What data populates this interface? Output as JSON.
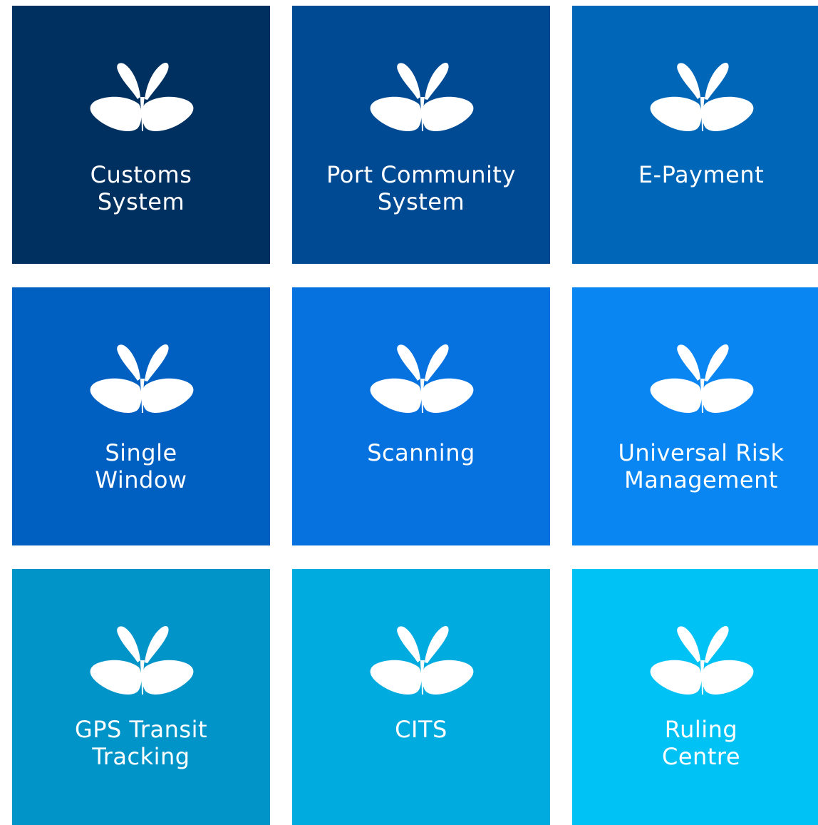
{
  "tiles": [
    {
      "id": "customs-system",
      "lines": [
        "Customs",
        "System"
      ],
      "color": "#00305f"
    },
    {
      "id": "port-community-system",
      "lines": [
        "Port Community",
        "System"
      ],
      "color": "#004a93"
    },
    {
      "id": "e-payment",
      "lines": [
        "E-Payment"
      ],
      "color": "#0067b8"
    },
    {
      "id": "single-window",
      "lines": [
        "Single",
        "Window"
      ],
      "color": "#0060c2"
    },
    {
      "id": "scanning",
      "lines": [
        "Scanning"
      ],
      "color": "#0672e0"
    },
    {
      "id": "universal-risk-management",
      "lines": [
        "Universal Risk",
        "Management"
      ],
      "color": "#0a86f2"
    },
    {
      "id": "gps-transit-tracking",
      "lines": [
        "GPS Transit",
        "Tracking"
      ],
      "color": "#0094c8"
    },
    {
      "id": "cits",
      "lines": [
        "CITS"
      ],
      "color": "#00abdf"
    },
    {
      "id": "ruling-centre",
      "lines": [
        "Ruling",
        "Centre"
      ],
      "color": "#00c2f5"
    }
  ],
  "icon": "leaf-sprout-icon"
}
